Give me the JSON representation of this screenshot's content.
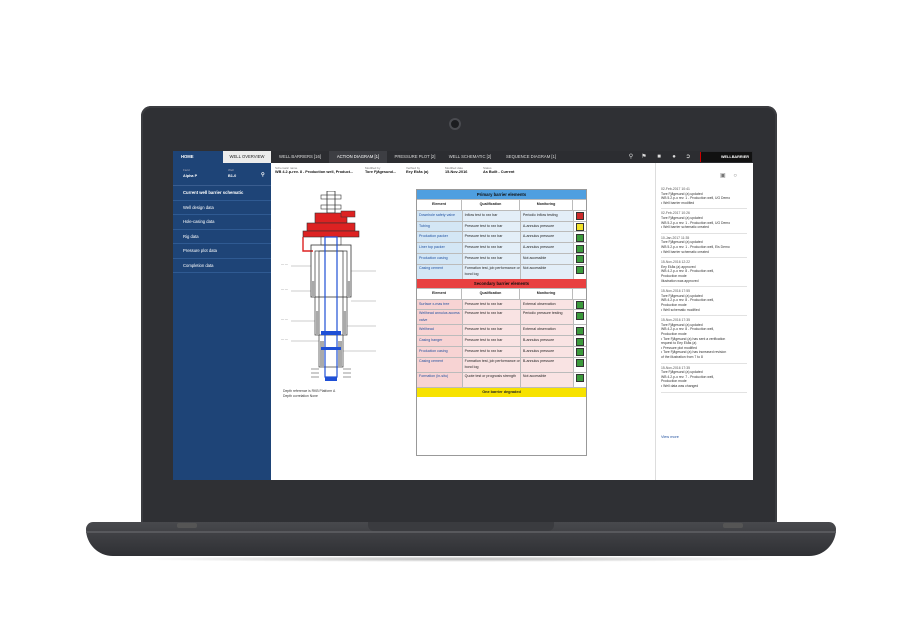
{
  "app": {
    "home_label": "HOME",
    "tabs": [
      {
        "label": "WELL OVERVIEW"
      },
      {
        "label": "WELL BARRIERS [16]"
      },
      {
        "label": "ACTION DIAGRAM [1]"
      },
      {
        "label": "PRESSURE PLOT [2]"
      },
      {
        "label": "WELL SCHEMATIC [2]"
      },
      {
        "label": "SEQUENCE DIAGRAM [1]"
      }
    ],
    "brand": "WELLBARRIER"
  },
  "sidebar": {
    "field_label": "Field",
    "field_value": "Alpha P",
    "well_label": "Well",
    "well_value": "B1-0",
    "items": [
      {
        "label": "Current well barrier schematic"
      },
      {
        "label": "Well design data"
      },
      {
        "label": "Hole-casing data"
      },
      {
        "label": "Rig data"
      },
      {
        "label": "Pressure plot data"
      },
      {
        "label": "Completion data"
      }
    ]
  },
  "meta": {
    "schematic_label": "Schematic name",
    "schematic_value": "WB 4.2.p-rev. 8 - Production well, Product...",
    "modified_label": "Modified by",
    "modified_value": "Tore Fjågesund...",
    "verified_label": "Verified by",
    "verified_value": "Eey Ekås (a)",
    "date_label": "Modified date",
    "date_value": "15-Nov-2016",
    "status_label": "Status",
    "status_value": "As Built - Current"
  },
  "diagram_caption": {
    "line1": "Depth reference is RKB Platform A",
    "line2": "Depth correlation None"
  },
  "barrier_table": {
    "primary_title": "Primary barrier elements",
    "secondary_title": "Secondary barrier elements",
    "headers": {
      "element": "Element",
      "qualification": "Qualification",
      "monitoring": "Monitoring"
    },
    "primary": [
      {
        "element": "Downhole safety valve",
        "qualification": "Inflow test to xxx bar",
        "monitoring": "Periodic inflow testing",
        "status": "#cc2a2a"
      },
      {
        "element": "Tubing",
        "qualification": "Pressure test to xxx bar",
        "monitoring": "A-annulus pressure",
        "status": "#f2e12a"
      },
      {
        "element": "Production packer",
        "qualification": "Pressure test to xxx bar",
        "monitoring": "A-annulus pressure",
        "status": "#3c9a3c"
      },
      {
        "element": "Liner top packer",
        "qualification": "Pressure test to xxx bar",
        "monitoring": "A-annulus pressure",
        "status": "#3c9a3c"
      },
      {
        "element": "Production casing",
        "qualification": "Pressure test to xxx bar",
        "monitoring": "Not accessible",
        "status": "#3c9a3c"
      },
      {
        "element": "Casing cement",
        "qualification": "Formation test, job performance or bond log",
        "monitoring": "Not accessible",
        "status": "#3c9a3c"
      }
    ],
    "secondary": [
      {
        "element": "Surface x-mas tree",
        "qualification": "Pressure test to xxx bar",
        "monitoring": "External observation",
        "status": "#3c9a3c"
      },
      {
        "element": "Wellhead annulus access valve",
        "qualification": "Pressure test to xxx bar",
        "monitoring": "Periodic pressure testing",
        "status": "#3c9a3c"
      },
      {
        "element": "Wellhead",
        "qualification": "Pressure test to xxx bar",
        "monitoring": "External observation",
        "status": "#3c9a3c"
      },
      {
        "element": "Casing hanger",
        "qualification": "Pressure test to xxx bar",
        "monitoring": "B-annulus pressure",
        "status": "#3c9a3c"
      },
      {
        "element": "Production casing",
        "qualification": "Pressure test to xxx bar",
        "monitoring": "B-annulus pressure",
        "status": "#3c9a3c"
      },
      {
        "element": "Casing cement",
        "qualification": "Formation test, job performance or bond log",
        "monitoring": "B-annulus pressure",
        "status": "#3c9a3c"
      },
      {
        "element": "Formation (in-situ)",
        "qualification": "Quote test or prognosis strength",
        "monitoring": "Not accessible",
        "status": "#3c9a3c"
      }
    ],
    "footer": "One barrier degraded"
  },
  "activity": {
    "events": [
      {
        "date": "02-Feb-2017 10:41",
        "lines": [
          "Tore Fjågesund (a) updated",
          "WB 5.2.p-o rev. 1 - Production well, UG Demo",
          "• Well barrier modified"
        ]
      },
      {
        "date": "02-Feb-2017 10:26",
        "lines": [
          "Tore Fjågesund (a) updated",
          "WB 5.2.p-o rev. 1 - Production well, UG Demo",
          "• Well barrier schematic created"
        ]
      },
      {
        "date": "10-Jan-2017 11:35",
        "lines": [
          "Tore Fjågesund (a) updated",
          "WB 5.2.p-o rev. 1 - Production well, Eis Demo",
          "• Well barrier schematic created"
        ]
      },
      {
        "date": "15-Nov-2016 12:22",
        "lines": [
          "Eey Ekås (a) approved",
          "WB 4.2.p-o rev. 8 - Production well,",
          "Production mode",
          "Illustration was approved"
        ]
      },
      {
        "date": "15-Nov-2016 17:55",
        "lines": [
          "Tore Fjågesund (a) updated",
          "WB 4.2.p-o rev. 8 - Production well,",
          "Production mode",
          "• Well schematic modified"
        ]
      },
      {
        "date": "15-Nov-2016 17:35",
        "lines": [
          "Tore Fjågesund (a) updated",
          "WB 4.2.p-o rev. 8 - Production well,",
          "Production mode",
          "• Tore Fjågesund (a) has sent a verification",
          "  request to Eey Ekås (a)",
          "• Pressure plot modified",
          "• Tore Fjågesund (a) has increased revision",
          "  of the illustration from 7 to 8"
        ]
      },
      {
        "date": "15-Nov-2016 17:35",
        "lines": [
          "Tore Fjågesund (a) updated",
          "WB 4.2.p-o rev. 7 - Production well,",
          "Production mode",
          "• Well data was changed"
        ]
      }
    ],
    "view_more": "View more"
  }
}
